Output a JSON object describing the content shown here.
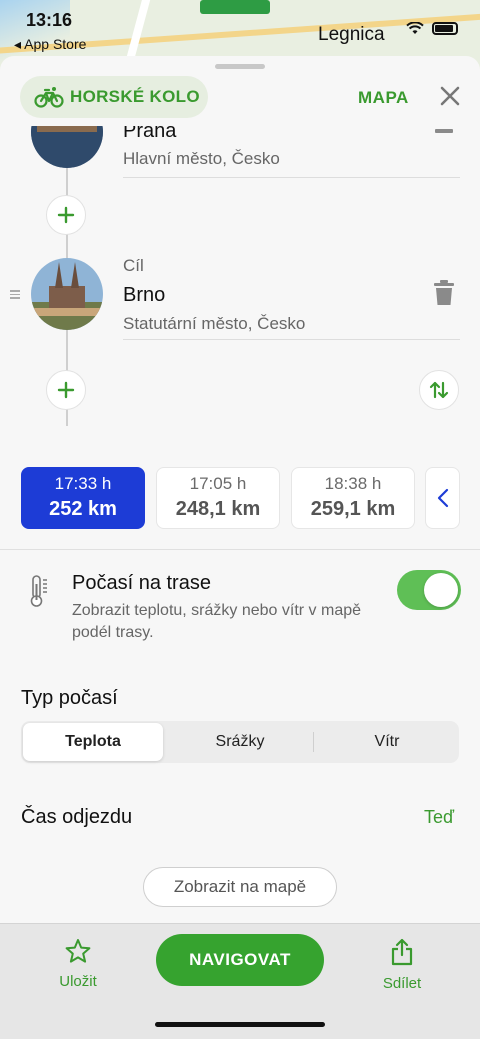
{
  "status": {
    "time": "13:16",
    "back_app": "◂ App Store",
    "map_label": "Legnica"
  },
  "header": {
    "profile_label": "HORSKÉ KOLO",
    "map_button": "MAPA"
  },
  "waypoints": [
    {
      "role": "",
      "name": "Praha",
      "subtitle": "Hlavní město, Česko"
    },
    {
      "role": "Cíl",
      "name": "Brno",
      "subtitle": "Statutární město, Česko"
    }
  ],
  "routes": [
    {
      "time": "17:33 h",
      "distance": "252 km",
      "selected": true
    },
    {
      "time": "17:05 h",
      "distance": "248,1 km",
      "selected": false
    },
    {
      "time": "18:38 h",
      "distance": "259,1 km",
      "selected": false
    }
  ],
  "weather": {
    "title": "Počasí na trase",
    "description": "Zobrazit teplotu, srážky nebo vítr v mapě podél trasy.",
    "enabled": true
  },
  "weather_type": {
    "title": "Typ počasí",
    "options": [
      "Teplota",
      "Srážky",
      "Vítr"
    ],
    "selected": "Teplota"
  },
  "departure": {
    "label": "Čas odjezdu",
    "value": "Teď"
  },
  "show_on_map": "Zobrazit na mapě",
  "bottom": {
    "save": "Uložit",
    "navigate": "NAVIGOVAT",
    "share": "Sdílet"
  },
  "colors": {
    "accent": "#36a32f",
    "selected_route": "#1d3cd6"
  }
}
